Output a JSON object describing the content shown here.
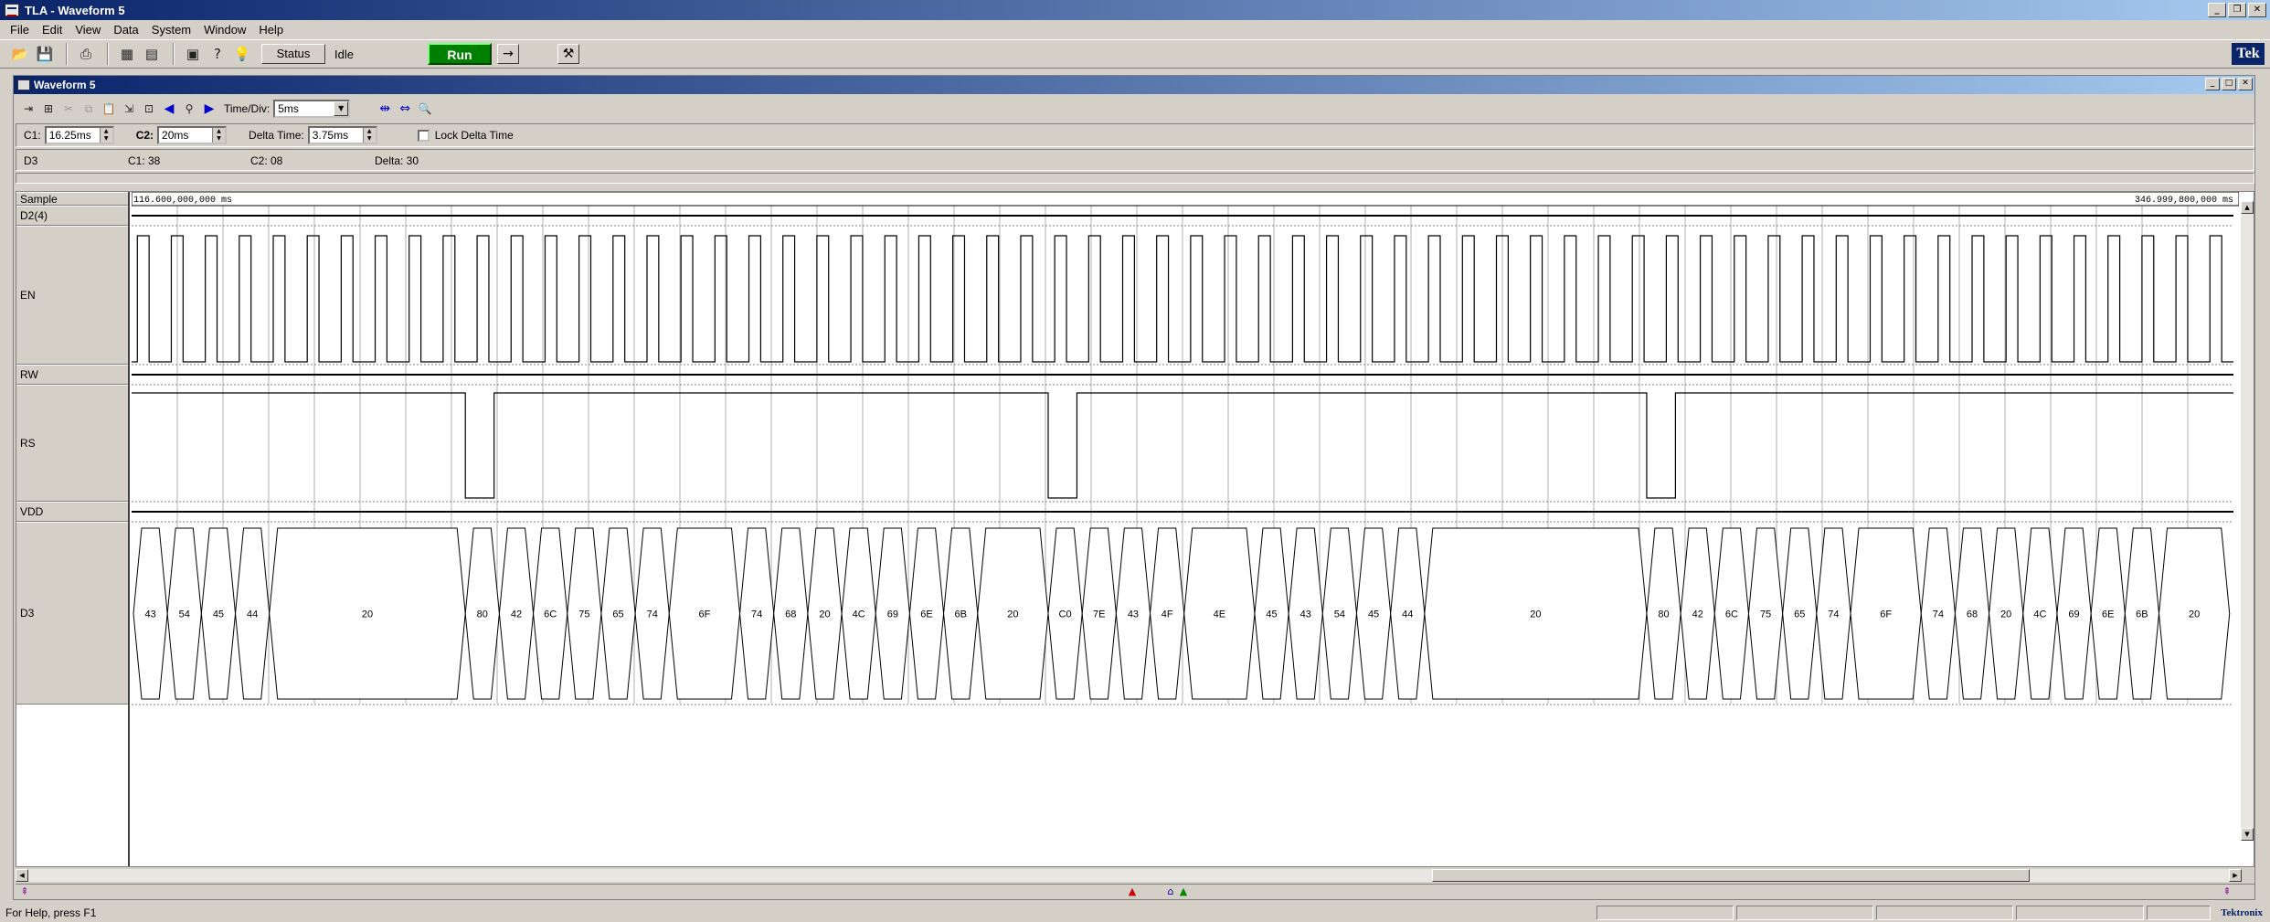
{
  "app": {
    "title": "TLA - Waveform 5",
    "menu": [
      "File",
      "Edit",
      "View",
      "Data",
      "System",
      "Window",
      "Help"
    ],
    "status_button": "Status",
    "status_text": "Idle",
    "run_label": "Run",
    "logo": "Tek",
    "statusbar_text": "For Help, press F1",
    "statusbar_logo": "Tektronix"
  },
  "window": {
    "title": "Waveform 5",
    "time_div_label": "Time/Div:",
    "time_div_value": "5ms",
    "c1_label": "C1:",
    "c1_value": "16.25ms",
    "c2_label": "C2:",
    "c2_value": "20ms",
    "delta_label": "Delta Time:",
    "delta_value": "3.75ms",
    "lock_label": "Lock Delta Time",
    "info": {
      "channel": "D3",
      "c1": "C1: 38",
      "c2": "C2: 08",
      "delta": "Delta: 30"
    }
  },
  "waveform": {
    "start_time": "116.600,000,000 ms",
    "end_time": "346.999,800,000 ms",
    "channels": [
      "Sample",
      "D2(4)",
      "EN",
      "RW",
      "RS",
      "VDD",
      "D3"
    ],
    "d3_bus": [
      {
        "v": "43",
        "s": 0.0,
        "e": 1.3
      },
      {
        "v": "54",
        "s": 1.3,
        "e": 2.6
      },
      {
        "v": "45",
        "s": 2.6,
        "e": 3.9
      },
      {
        "v": "44",
        "s": 3.9,
        "e": 5.2
      },
      {
        "v": "20",
        "s": 5.2,
        "e": 12.7
      },
      {
        "v": "80",
        "s": 12.7,
        "e": 14.0
      },
      {
        "v": "42",
        "s": 14.0,
        "e": 15.3
      },
      {
        "v": "6C",
        "s": 15.3,
        "e": 16.6
      },
      {
        "v": "75",
        "s": 16.6,
        "e": 17.9
      },
      {
        "v": "65",
        "s": 17.9,
        "e": 19.2
      },
      {
        "v": "74",
        "s": 19.2,
        "e": 20.5
      },
      {
        "v": "6F",
        "s": 20.5,
        "e": 23.2
      },
      {
        "v": "74",
        "s": 23.2,
        "e": 24.5
      },
      {
        "v": "68",
        "s": 24.5,
        "e": 25.8
      },
      {
        "v": "20",
        "s": 25.8,
        "e": 27.1
      },
      {
        "v": "4C",
        "s": 27.1,
        "e": 28.4
      },
      {
        "v": "69",
        "s": 28.4,
        "e": 29.7
      },
      {
        "v": "6E",
        "s": 29.7,
        "e": 31.0
      },
      {
        "v": "6B",
        "s": 31.0,
        "e": 32.3
      },
      {
        "v": "20",
        "s": 32.3,
        "e": 35.0
      },
      {
        "v": "C0",
        "s": 35.0,
        "e": 36.3
      },
      {
        "v": "7E",
        "s": 36.3,
        "e": 37.6
      },
      {
        "v": "43",
        "s": 37.6,
        "e": 38.9
      },
      {
        "v": "4F",
        "s": 38.9,
        "e": 40.2
      },
      {
        "v": "4E",
        "s": 40.2,
        "e": 42.9
      },
      {
        "v": "45",
        "s": 42.9,
        "e": 44.2
      },
      {
        "v": "43",
        "s": 44.2,
        "e": 45.5
      },
      {
        "v": "54",
        "s": 45.5,
        "e": 46.8
      },
      {
        "v": "45",
        "s": 46.8,
        "e": 48.1
      },
      {
        "v": "44",
        "s": 48.1,
        "e": 49.4
      },
      {
        "v": "20",
        "s": 49.4,
        "e": 57.9
      },
      {
        "v": "80",
        "s": 57.9,
        "e": 59.2
      },
      {
        "v": "42",
        "s": 59.2,
        "e": 60.5
      },
      {
        "v": "6C",
        "s": 60.5,
        "e": 61.8
      },
      {
        "v": "75",
        "s": 61.8,
        "e": 63.1
      },
      {
        "v": "65",
        "s": 63.1,
        "e": 64.4
      },
      {
        "v": "74",
        "s": 64.4,
        "e": 65.7
      },
      {
        "v": "6F",
        "s": 65.7,
        "e": 68.4
      },
      {
        "v": "74",
        "s": 68.4,
        "e": 69.7
      },
      {
        "v": "68",
        "s": 69.7,
        "e": 71.0
      },
      {
        "v": "20",
        "s": 71.0,
        "e": 72.3
      },
      {
        "v": "4C",
        "s": 72.3,
        "e": 73.6
      },
      {
        "v": "69",
        "s": 73.6,
        "e": 74.9
      },
      {
        "v": "6E",
        "s": 74.9,
        "e": 76.2
      },
      {
        "v": "6B",
        "s": 76.2,
        "e": 77.5
      },
      {
        "v": "20",
        "s": 77.5,
        "e": 80.2
      }
    ],
    "rs_low_windows": [
      [
        12.7,
        13.8
      ],
      [
        35.0,
        36.1
      ],
      [
        57.9,
        59.0
      ]
    ]
  },
  "colors": {
    "titlebar_start": "#0a246a",
    "titlebar_end": "#a6caf0",
    "run_green": "#008000"
  }
}
